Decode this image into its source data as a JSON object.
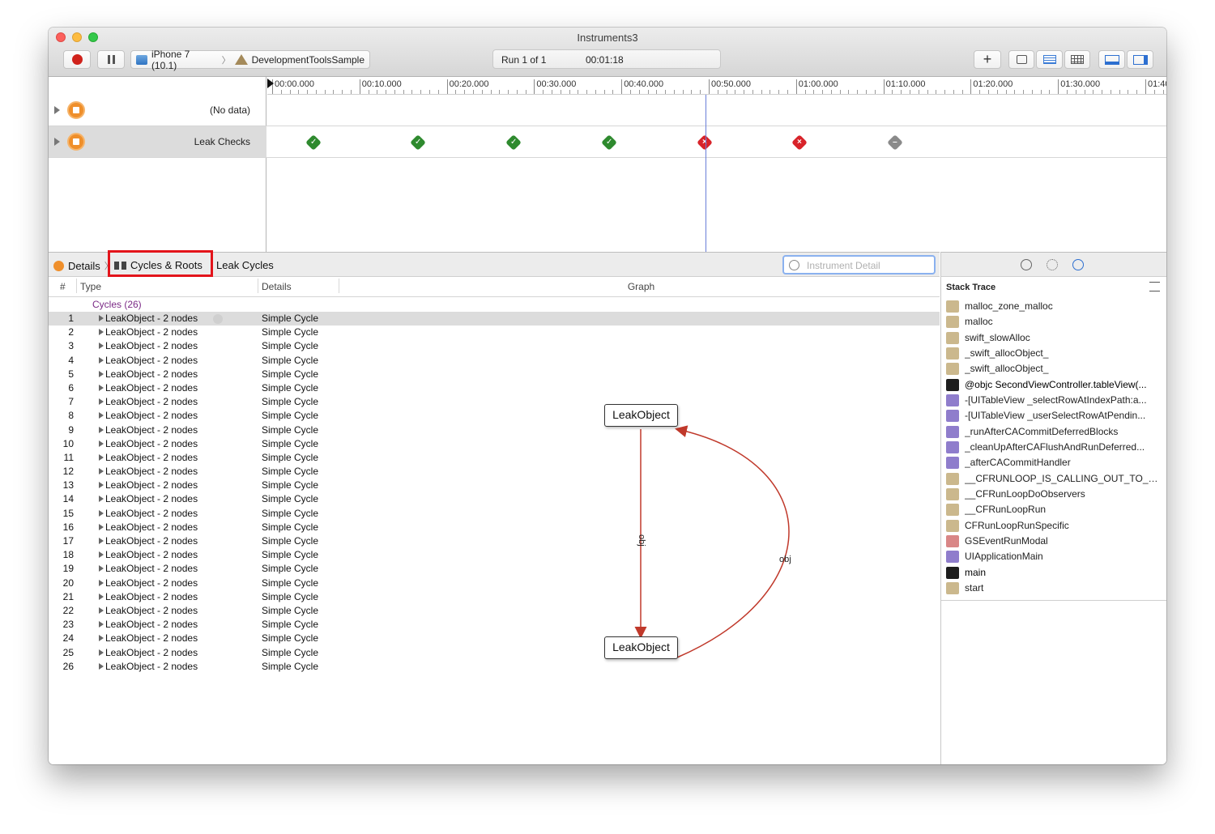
{
  "window": {
    "title": "Instruments3"
  },
  "toolbar": {
    "device": "iPhone 7 (10.1)",
    "target": "DevelopmentToolsSample",
    "run": "Run 1 of 1",
    "elapsed": "00:01:18",
    "add_label": "+"
  },
  "timeline": {
    "ticks": [
      "00:00.000",
      "00:10.000",
      "00:20.000",
      "00:30.000",
      "00:40.000",
      "00:50.000",
      "01:00.000",
      "01:10.000",
      "01:20.000",
      "01:30.000",
      "01:40.0"
    ],
    "tracks": [
      {
        "name": "(No data)"
      },
      {
        "name": "Leak Checks"
      }
    ],
    "leak_check_status": [
      "ok",
      "ok",
      "ok",
      "ok",
      "leak",
      "leak",
      "none"
    ]
  },
  "detail": {
    "jump_details": "Details",
    "jump_cycles": "Cycles & Roots",
    "jump_leak_cycles": "Leak Cycles",
    "search_placeholder": "Instrument Detail"
  },
  "table": {
    "col_num": "#",
    "col_type": "Type",
    "col_details": "Details",
    "col_graph": "Graph",
    "group_label": "Cycles (26)",
    "rows": [
      {
        "n": "1",
        "type": "LeakObject - 2 nodes",
        "details": "Simple Cycle"
      },
      {
        "n": "2",
        "type": "LeakObject - 2 nodes",
        "details": "Simple Cycle"
      },
      {
        "n": "3",
        "type": "LeakObject - 2 nodes",
        "details": "Simple Cycle"
      },
      {
        "n": "4",
        "type": "LeakObject - 2 nodes",
        "details": "Simple Cycle"
      },
      {
        "n": "5",
        "type": "LeakObject - 2 nodes",
        "details": "Simple Cycle"
      },
      {
        "n": "6",
        "type": "LeakObject - 2 nodes",
        "details": "Simple Cycle"
      },
      {
        "n": "7",
        "type": "LeakObject - 2 nodes",
        "details": "Simple Cycle"
      },
      {
        "n": "8",
        "type": "LeakObject - 2 nodes",
        "details": "Simple Cycle"
      },
      {
        "n": "9",
        "type": "LeakObject - 2 nodes",
        "details": "Simple Cycle"
      },
      {
        "n": "10",
        "type": "LeakObject - 2 nodes",
        "details": "Simple Cycle"
      },
      {
        "n": "11",
        "type": "LeakObject - 2 nodes",
        "details": "Simple Cycle"
      },
      {
        "n": "12",
        "type": "LeakObject - 2 nodes",
        "details": "Simple Cycle"
      },
      {
        "n": "13",
        "type": "LeakObject - 2 nodes",
        "details": "Simple Cycle"
      },
      {
        "n": "14",
        "type": "LeakObject - 2 nodes",
        "details": "Simple Cycle"
      },
      {
        "n": "15",
        "type": "LeakObject - 2 nodes",
        "details": "Simple Cycle"
      },
      {
        "n": "16",
        "type": "LeakObject - 2 nodes",
        "details": "Simple Cycle"
      },
      {
        "n": "17",
        "type": "LeakObject - 2 nodes",
        "details": "Simple Cycle"
      },
      {
        "n": "18",
        "type": "LeakObject - 2 nodes",
        "details": "Simple Cycle"
      },
      {
        "n": "19",
        "type": "LeakObject - 2 nodes",
        "details": "Simple Cycle"
      },
      {
        "n": "20",
        "type": "LeakObject - 2 nodes",
        "details": "Simple Cycle"
      },
      {
        "n": "21",
        "type": "LeakObject - 2 nodes",
        "details": "Simple Cycle"
      },
      {
        "n": "22",
        "type": "LeakObject - 2 nodes",
        "details": "Simple Cycle"
      },
      {
        "n": "23",
        "type": "LeakObject - 2 nodes",
        "details": "Simple Cycle"
      },
      {
        "n": "24",
        "type": "LeakObject - 2 nodes",
        "details": "Simple Cycle"
      },
      {
        "n": "25",
        "type": "LeakObject - 2 nodes",
        "details": "Simple Cycle"
      },
      {
        "n": "26",
        "type": "LeakObject - 2 nodes",
        "details": "Simple Cycle"
      }
    ]
  },
  "graph": {
    "node_top": "LeakObject",
    "node_bottom": "LeakObject",
    "edge_down": "obj",
    "edge_up": "obj",
    "edge_color": "#c0392b"
  },
  "inspector": {
    "title": "Stack Trace",
    "frames": [
      {
        "label": "malloc_zone_malloc",
        "icon": "gear-icon",
        "kind": "sys"
      },
      {
        "label": "malloc",
        "icon": "gear-icon",
        "kind": "sys"
      },
      {
        "label": "swift_slowAlloc",
        "icon": "library-icon",
        "kind": "lib"
      },
      {
        "label": "_swift_allocObject_",
        "icon": "library-icon",
        "kind": "lib"
      },
      {
        "label": "_swift_allocObject_",
        "icon": "library-icon",
        "kind": "lib"
      },
      {
        "label": "@objc SecondViewController.tableView(...",
        "icon": "user-icon",
        "kind": "user"
      },
      {
        "label": "-[UITableView _selectRowAtIndexPath:a...",
        "icon": "framework-icon",
        "kind": "ui"
      },
      {
        "label": "-[UITableView _userSelectRowAtPendin...",
        "icon": "framework-icon",
        "kind": "ui"
      },
      {
        "label": "_runAfterCACommitDeferredBlocks",
        "icon": "framework-icon",
        "kind": "ui"
      },
      {
        "label": "_cleanUpAfterCAFlushAndRunDeferred...",
        "icon": "framework-icon",
        "kind": "ui"
      },
      {
        "label": "_afterCACommitHandler",
        "icon": "framework-icon",
        "kind": "ui"
      },
      {
        "label": "__CFRUNLOOP_IS_CALLING_OUT_TO_A...",
        "icon": "framework-icon",
        "kind": "lib"
      },
      {
        "label": "__CFRunLoopDoObservers",
        "icon": "framework-icon",
        "kind": "lib"
      },
      {
        "label": "__CFRunLoopRun",
        "icon": "framework-icon",
        "kind": "lib"
      },
      {
        "label": "CFRunLoopRunSpecific",
        "icon": "framework-icon",
        "kind": "lib"
      },
      {
        "label": "GSEventRunModal",
        "icon": "toolbox-icon",
        "kind": "gs"
      },
      {
        "label": "UIApplicationMain",
        "icon": "framework-icon",
        "kind": "ui"
      },
      {
        "label": "main",
        "icon": "user-icon",
        "kind": "user"
      },
      {
        "label": "start",
        "icon": "gear-icon",
        "kind": "sys"
      }
    ]
  }
}
